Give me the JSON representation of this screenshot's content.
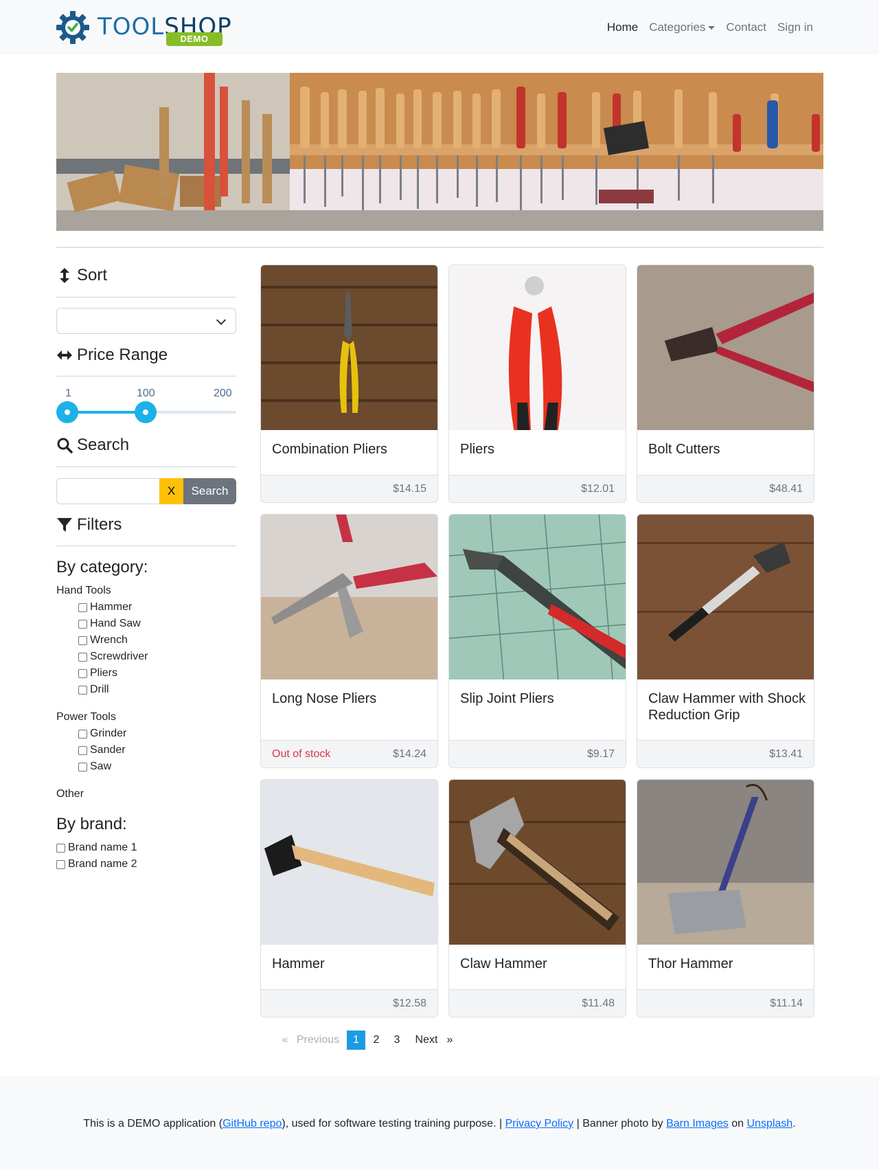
{
  "navbar": {
    "brand_prefix": "TOOL",
    "brand_suffix": "SHOP",
    "demo_badge": "DEMO",
    "links": {
      "home": "Home",
      "categories": "Categories",
      "contact": "Contact",
      "sign_in": "Sign in"
    }
  },
  "sidebar": {
    "sort": {
      "heading": "Sort",
      "selected": ""
    },
    "price_range": {
      "heading": "Price Range",
      "min_label": "1",
      "value_label": "100",
      "max_label": "200",
      "min": 1,
      "max": 200,
      "low": 1,
      "high": 100
    },
    "search": {
      "heading": "Search",
      "value": "",
      "clear_label": "X",
      "submit_label": "Search"
    },
    "filters": {
      "heading": "Filters",
      "by_category": "By category:",
      "groups": [
        {
          "label": "Hand Tools",
          "items": [
            "Hammer",
            "Hand Saw",
            "Wrench",
            "Screwdriver",
            "Pliers",
            "Drill"
          ]
        },
        {
          "label": "Power Tools",
          "items": [
            "Grinder",
            "Sander",
            "Saw"
          ]
        },
        {
          "label": "Other",
          "items": []
        }
      ],
      "by_brand": "By brand:",
      "brands": [
        "Brand name 1",
        "Brand name 2"
      ]
    }
  },
  "products": [
    {
      "name": "Combination Pliers",
      "price": "$14.15",
      "status": ""
    },
    {
      "name": "Pliers",
      "price": "$12.01",
      "status": ""
    },
    {
      "name": "Bolt Cutters",
      "price": "$48.41",
      "status": ""
    },
    {
      "name": "Long Nose Pliers",
      "price": "$14.24",
      "status": "Out of stock"
    },
    {
      "name": "Slip Joint Pliers",
      "price": "$9.17",
      "status": ""
    },
    {
      "name": "Claw Hammer with Shock Reduction Grip",
      "price": "$13.41",
      "status": ""
    },
    {
      "name": "Hammer",
      "price": "$12.58",
      "status": ""
    },
    {
      "name": "Claw Hammer",
      "price": "$11.48",
      "status": ""
    },
    {
      "name": "Thor Hammer",
      "price": "$11.14",
      "status": ""
    }
  ],
  "pagination": {
    "prev_symbol": "«",
    "previous": "Previous",
    "pages": [
      "1",
      "2",
      "3"
    ],
    "current": "1",
    "next": "Next",
    "next_symbol": "»"
  },
  "footer": {
    "text_1": "This is a DEMO application (",
    "github_link": "GitHub repo",
    "text_2": "), used for software testing training purpose. | ",
    "privacy_link": "Privacy Policy",
    "text_3": " | Banner photo by ",
    "barn_link": "Barn Images",
    "text_4": " on ",
    "unsplash_link": "Unsplash",
    "text_5": "."
  },
  "colors": {
    "accent": "#1cb1e8",
    "out_of_stock": "#dc3545",
    "clear_button": "#ffc107",
    "search_button": "#6c757d",
    "demo_badge": "#86bd27",
    "pagination_active": "#1c9be3"
  }
}
